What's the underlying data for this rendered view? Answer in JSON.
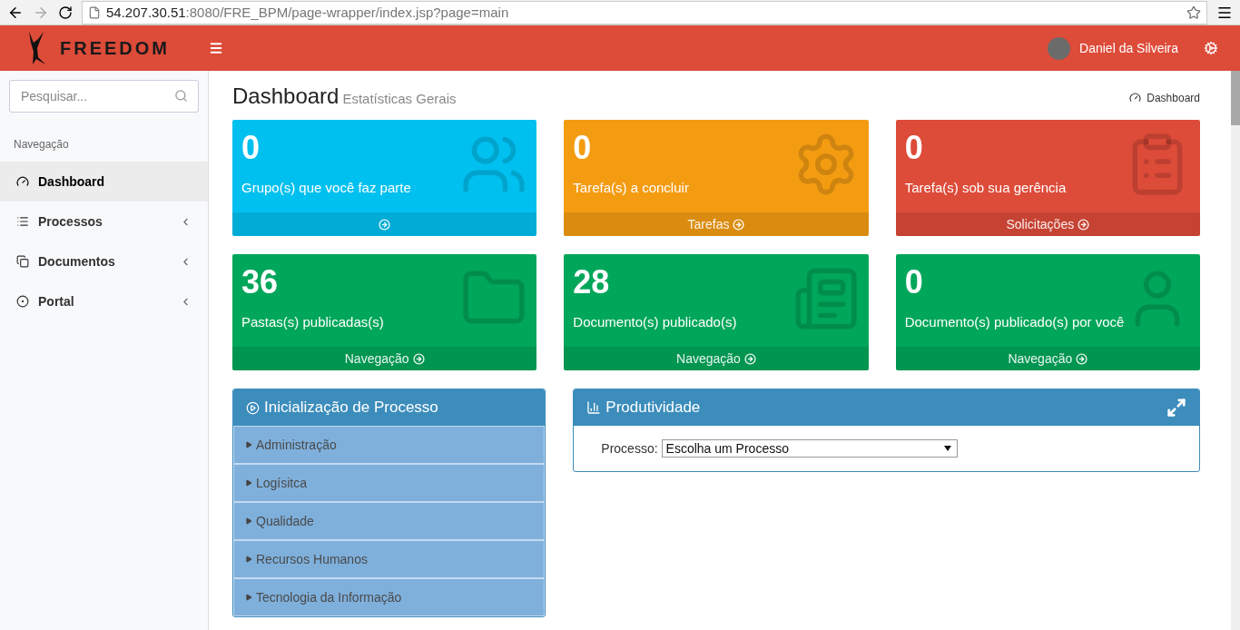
{
  "browser": {
    "url_host": "54.207.30.51",
    "url_path": ":8080/FRE_BPM/page-wrapper/index.jsp?page=main"
  },
  "header": {
    "brand": "FREEDOM",
    "user": "Daniel da Silveira"
  },
  "sidebar": {
    "search": {
      "placeholder": "Pesquisar..."
    },
    "section": "Navegação",
    "items": [
      {
        "label": "Dashboard",
        "selected": true,
        "expandable": false
      },
      {
        "label": "Processos",
        "selected": false,
        "expandable": true
      },
      {
        "label": "Documentos",
        "selected": false,
        "expandable": true
      },
      {
        "label": "Portal",
        "selected": false,
        "expandable": true
      }
    ]
  },
  "page": {
    "title": "Dashboard",
    "subtitle": "Estatísticas Gerais",
    "breadcrumb": "Dashboard"
  },
  "cards": [
    {
      "value": "0",
      "label": "Grupo(s) que você faz parte",
      "color": "#00c0ef"
    },
    {
      "value": "0",
      "label": "Tarefa(s) a concluir",
      "color": "#f39c12",
      "footer": "Tarefas"
    },
    {
      "value": "0",
      "label": "Tarefa(s) sob sua gerência",
      "color": "#dd4b39",
      "footer": "Solicitações"
    },
    {
      "value": "36",
      "label": "Pastas(s) publicadas(s)",
      "color": "#00a65a",
      "footer": "Navegação"
    },
    {
      "value": "28",
      "label": "Documento(s) publicado(s)",
      "color": "#00a65a",
      "footer": "Navegação"
    },
    {
      "value": "0",
      "label": "Documento(s) publicado(s) por você",
      "color": "#00a65a",
      "footer": "Navegação"
    }
  ],
  "process_panel": {
    "title": "Inicialização de Processo",
    "items": [
      "Administração",
      "Logísitca",
      "Qualidade",
      "Recursos Humanos",
      "Tecnologia da Informação"
    ]
  },
  "productivity_panel": {
    "title": "Produtividade",
    "field_label": "Processo:",
    "select_value": "Escolha um Processo"
  }
}
